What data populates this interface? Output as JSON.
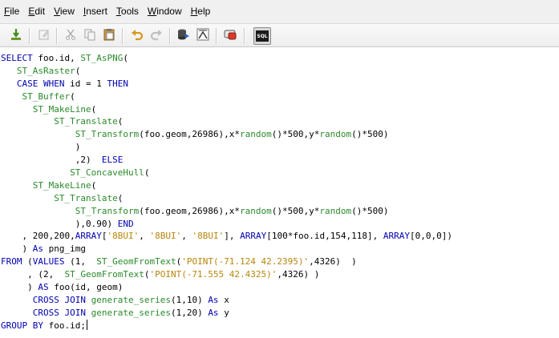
{
  "menubar": {
    "items": [
      {
        "label": "File",
        "key": "F",
        "rest": "ile"
      },
      {
        "label": "Edit",
        "key": "E",
        "rest": "dit"
      },
      {
        "label": "View",
        "key": "V",
        "rest": "iew"
      },
      {
        "label": "Insert",
        "key": "I",
        "rest": "nsert"
      },
      {
        "label": "Tools",
        "key": "T",
        "rest": "ools"
      },
      {
        "label": "Window",
        "key": "W",
        "rest": "indow"
      },
      {
        "label": "Help",
        "key": "H",
        "rest": "elp"
      }
    ]
  },
  "toolbar": {
    "sql_label": "SQL",
    "buttons": [
      "execute-icon",
      "edit-icon",
      "cut-icon",
      "copy-icon",
      "paste-icon",
      "undo-icon",
      "redo-icon",
      "database-run-icon",
      "explain-icon",
      "clear-icon",
      "sql-icon"
    ]
  },
  "colors": {
    "keyword": "#0000b0",
    "function": "#2a8a2a",
    "string": "#b8860b",
    "plain": "#000000"
  },
  "editor": {
    "lines": [
      [
        [
          "kw",
          "SELECT "
        ],
        [
          "plain",
          "foo.id, "
        ],
        [
          "fn",
          "ST_AsPNG"
        ],
        [
          "plain",
          "("
        ]
      ],
      [
        [
          "plain",
          "   "
        ],
        [
          "fn",
          "ST_AsRaster"
        ],
        [
          "plain",
          "("
        ]
      ],
      [
        [
          "plain",
          "   "
        ],
        [
          "kw",
          "CASE WHEN "
        ],
        [
          "plain",
          "id = 1 "
        ],
        [
          "kw",
          "THEN"
        ]
      ],
      [
        [
          "plain",
          "    "
        ],
        [
          "fn",
          "ST_Buffer"
        ],
        [
          "plain",
          "("
        ]
      ],
      [
        [
          "plain",
          "      "
        ],
        [
          "fn",
          "ST_MakeLine"
        ],
        [
          "plain",
          "("
        ]
      ],
      [
        [
          "plain",
          "          "
        ],
        [
          "fn",
          "ST_Translate"
        ],
        [
          "plain",
          "("
        ]
      ],
      [
        [
          "plain",
          "              "
        ],
        [
          "fn",
          "ST_Transform"
        ],
        [
          "plain",
          "(foo.geom,26986),"
        ],
        [
          "plain",
          "x*"
        ],
        [
          "fn",
          "random"
        ],
        [
          "plain",
          "()*500,"
        ],
        [
          "plain",
          "y*"
        ],
        [
          "fn",
          "random"
        ],
        [
          "plain",
          "()*500)"
        ]
      ],
      [
        [
          "plain",
          "              )"
        ]
      ],
      [
        [
          "plain",
          "              ,2)  "
        ],
        [
          "kw",
          "ELSE"
        ]
      ],
      [
        [
          "plain",
          "             "
        ],
        [
          "fn",
          "ST_ConcaveHull"
        ],
        [
          "plain",
          "("
        ]
      ],
      [
        [
          "plain",
          "      "
        ],
        [
          "fn",
          "ST_MakeLine"
        ],
        [
          "plain",
          "("
        ]
      ],
      [
        [
          "plain",
          "          "
        ],
        [
          "fn",
          "ST_Translate"
        ],
        [
          "plain",
          "("
        ]
      ],
      [
        [
          "plain",
          "              "
        ],
        [
          "fn",
          "ST_Transform"
        ],
        [
          "plain",
          "(foo.geom,26986),"
        ],
        [
          "plain",
          "x*"
        ],
        [
          "fn",
          "random"
        ],
        [
          "plain",
          "()*500,"
        ],
        [
          "plain",
          "y*"
        ],
        [
          "fn",
          "random"
        ],
        [
          "plain",
          "()*500)"
        ]
      ],
      [
        [
          "plain",
          "              ),0.90) "
        ],
        [
          "kw",
          "END"
        ]
      ],
      [
        [
          "plain",
          "    , 200,200,"
        ],
        [
          "kw",
          "ARRAY"
        ],
        [
          "plain",
          "["
        ],
        [
          "str",
          "'8BUI'"
        ],
        [
          "plain",
          ", "
        ],
        [
          "str",
          "'8BUI'"
        ],
        [
          "plain",
          ", "
        ],
        [
          "str",
          "'8BUI'"
        ],
        [
          "plain",
          "], "
        ],
        [
          "kw",
          "ARRAY"
        ],
        [
          "plain",
          "[100*foo.id,154,118], "
        ],
        [
          "kw",
          "ARRAY"
        ],
        [
          "plain",
          "[0,0,0])"
        ]
      ],
      [
        [
          "plain",
          "    ) "
        ],
        [
          "kw",
          "As "
        ],
        [
          "plain",
          "png_img"
        ]
      ],
      [
        [
          "kw",
          "FROM "
        ],
        [
          "plain",
          "("
        ],
        [
          "kw",
          "VALUES "
        ],
        [
          "plain",
          "(1,  "
        ],
        [
          "fn",
          "ST_GeomFromText"
        ],
        [
          "plain",
          "("
        ],
        [
          "str",
          "'POINT(-71.124 42.2395)'"
        ],
        [
          "plain",
          ",4326)  )"
        ]
      ],
      [
        [
          "plain",
          "     , (2,  "
        ],
        [
          "fn",
          "ST_GeomFromText"
        ],
        [
          "plain",
          "("
        ],
        [
          "str",
          "'POINT(-71.555 42.4325)'"
        ],
        [
          "plain",
          ",4326) )"
        ]
      ],
      [
        [
          "plain",
          "     ) "
        ],
        [
          "kw",
          "AS "
        ],
        [
          "plain",
          "foo(id, geom)"
        ]
      ],
      [
        [
          "plain",
          "      "
        ],
        [
          "kw",
          "CROSS JOIN "
        ],
        [
          "fn",
          "generate_series"
        ],
        [
          "plain",
          "(1,10) "
        ],
        [
          "kw",
          "As "
        ],
        [
          "plain",
          "x"
        ]
      ],
      [
        [
          "plain",
          "      "
        ],
        [
          "kw",
          "CROSS JOIN "
        ],
        [
          "fn",
          "generate_series"
        ],
        [
          "plain",
          "(1,20) "
        ],
        [
          "kw",
          "As "
        ],
        [
          "plain",
          "y"
        ]
      ],
      [
        [
          "kw",
          "GROUP BY "
        ],
        [
          "plain",
          "foo.id;"
        ]
      ]
    ]
  }
}
